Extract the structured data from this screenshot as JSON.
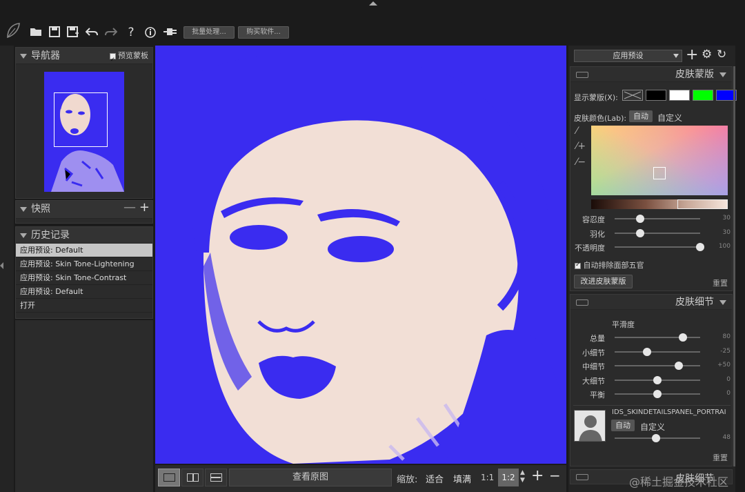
{
  "toolbar": {
    "batch_label": "批量处理...",
    "buy_label": "购买软件..."
  },
  "navigator": {
    "title": "导航器",
    "preview_mask_label": "预览蒙板",
    "preview_mask_checked": true
  },
  "snapshots": {
    "title": "快照"
  },
  "history": {
    "title": "历史记录",
    "items": [
      {
        "label": "应用预设: Default",
        "selected": true
      },
      {
        "label": "应用预设: Skin Tone-Lightening",
        "selected": false
      },
      {
        "label": "应用预设: Skin Tone-Contrast",
        "selected": false
      },
      {
        "label": "应用预设: Default",
        "selected": false
      },
      {
        "label": "打开",
        "selected": false
      }
    ]
  },
  "bottom_bar": {
    "view_original_label": "查看原图",
    "zoom_label": "缩放:",
    "fit_label": "适合",
    "fill_label": "填满",
    "zoom_1_1": "1:1",
    "zoom_1_2": "1:2"
  },
  "right": {
    "preset_select": "应用预设",
    "skin_mask": {
      "title": "皮肤蒙版",
      "show_mask_label": "显示蒙版(X):",
      "swatch_colors": [
        "#000000",
        "#ffffff",
        "#00ff00",
        "#0000ff"
      ],
      "skin_color_label": "皮肤颜色(Lab):",
      "auto_label": "自动",
      "custom_label": "自定义",
      "sliders": [
        {
          "label": "容忍度",
          "value": "30",
          "level": 0.3
        },
        {
          "label": "羽化",
          "value": "30",
          "level": 0.3
        },
        {
          "label": "不透明度",
          "value": "100",
          "level": 1.0
        }
      ],
      "auto_exclude_label": "自动排除面部五官",
      "auto_exclude_checked": true,
      "refine_label": "改进皮肤蒙版",
      "reset_label": "重置"
    },
    "skin_detail": {
      "title": "皮肤细节",
      "smooth_label": "平滑度",
      "sliders": [
        {
          "label": "总量",
          "value": "80",
          "level": 0.8
        },
        {
          "label": "小细节",
          "value": "-25",
          "level": 0.375
        },
        {
          "label": "中细节",
          "value": "+50",
          "level": 0.75
        },
        {
          "label": "大细节",
          "value": "0",
          "level": 0.5
        },
        {
          "label": "平衡",
          "value": "0",
          "level": 0.5
        }
      ],
      "portrait_label": "IDS_SKINDETAILSPANEL_PORTRAI",
      "auto_label": "自动",
      "custom_label": "自定义",
      "portrait_value": "48",
      "portrait_level": 0.48,
      "reset_label": "重置"
    },
    "bottom_section_title": "皮肤细节"
  },
  "watermark": "@稀土掘金技术社区"
}
